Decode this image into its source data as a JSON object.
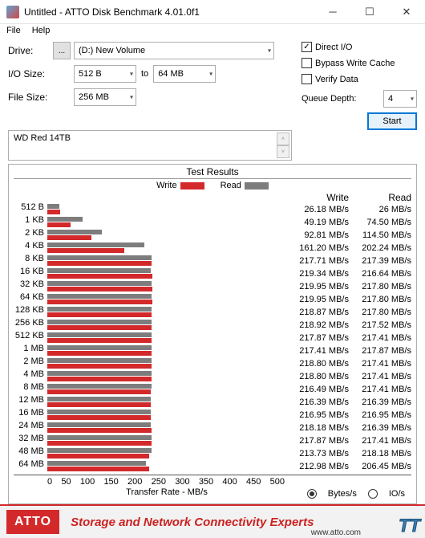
{
  "window": {
    "title": "Untitled - ATTO Disk Benchmark 4.01.0f1"
  },
  "menu": {
    "file": "File",
    "help": "Help"
  },
  "config": {
    "drive_label": "Drive:",
    "dots": "...",
    "drive_value": "(D:) New Volume",
    "io_label": "I/O Size:",
    "io_from": "512 B",
    "io_to_label": "to",
    "io_to": "64 MB",
    "fsize_label": "File Size:",
    "fsize_value": "256 MB"
  },
  "options": {
    "direct_io": "Direct I/O",
    "bypass": "Bypass Write Cache",
    "verify": "Verify Data",
    "qd_label": "Queue Depth:",
    "qd_value": "4",
    "start": "Start"
  },
  "description": "WD Red 14TB",
  "results": {
    "header": "Test Results",
    "write_label": "Write",
    "read_label": "Read",
    "transfer_label": "Transfer Rate - MB/s",
    "bytes_label": "Bytes/s",
    "ios_label": "IO/s"
  },
  "footer": {
    "logo": "ATTO",
    "slogan": "Storage and Network Connectivity Experts",
    "url": "www.atto.com",
    "watermark": "TT"
  },
  "chart_data": {
    "type": "bar",
    "xlabel": "Transfer Rate - MB/s",
    "xlim": [
      0,
      500
    ],
    "xticks": [
      0,
      50,
      100,
      150,
      200,
      250,
      300,
      350,
      400,
      450,
      500
    ],
    "series": [
      {
        "name": "Write",
        "color": "#d3292b"
      },
      {
        "name": "Read",
        "color": "#7d7d7d"
      }
    ],
    "rows": [
      {
        "label": "512 B",
        "write": 26.18,
        "read": 26.0,
        "write_s": "26.18 MB/s",
        "read_s": "26 MB/s"
      },
      {
        "label": "1 KB",
        "write": 49.19,
        "read": 74.5,
        "write_s": "49.19 MB/s",
        "read_s": "74.50 MB/s"
      },
      {
        "label": "2 KB",
        "write": 92.81,
        "read": 114.5,
        "write_s": "92.81 MB/s",
        "read_s": "114.50 MB/s"
      },
      {
        "label": "4 KB",
        "write": 161.2,
        "read": 202.24,
        "write_s": "161.20 MB/s",
        "read_s": "202.24 MB/s"
      },
      {
        "label": "8 KB",
        "write": 217.71,
        "read": 217.39,
        "write_s": "217.71 MB/s",
        "read_s": "217.39 MB/s"
      },
      {
        "label": "16 KB",
        "write": 219.34,
        "read": 216.64,
        "write_s": "219.34 MB/s",
        "read_s": "216.64 MB/s"
      },
      {
        "label": "32 KB",
        "write": 219.95,
        "read": 217.8,
        "write_s": "219.95 MB/s",
        "read_s": "217.80 MB/s"
      },
      {
        "label": "64 KB",
        "write": 219.95,
        "read": 217.8,
        "write_s": "219.95 MB/s",
        "read_s": "217.80 MB/s"
      },
      {
        "label": "128 KB",
        "write": 218.87,
        "read": 217.8,
        "write_s": "218.87 MB/s",
        "read_s": "217.80 MB/s"
      },
      {
        "label": "256 KB",
        "write": 218.92,
        "read": 217.52,
        "write_s": "218.92 MB/s",
        "read_s": "217.52 MB/s"
      },
      {
        "label": "512 KB",
        "write": 217.87,
        "read": 217.41,
        "write_s": "217.87 MB/s",
        "read_s": "217.41 MB/s"
      },
      {
        "label": "1 MB",
        "write": 217.41,
        "read": 217.87,
        "write_s": "217.41 MB/s",
        "read_s": "217.87 MB/s"
      },
      {
        "label": "2 MB",
        "write": 218.8,
        "read": 217.41,
        "write_s": "218.80 MB/s",
        "read_s": "217.41 MB/s"
      },
      {
        "label": "4 MB",
        "write": 218.8,
        "read": 217.41,
        "write_s": "218.80 MB/s",
        "read_s": "217.41 MB/s"
      },
      {
        "label": "8 MB",
        "write": 216.49,
        "read": 217.41,
        "write_s": "216.49 MB/s",
        "read_s": "217.41 MB/s"
      },
      {
        "label": "12 MB",
        "write": 216.39,
        "read": 216.39,
        "write_s": "216.39 MB/s",
        "read_s": "216.39 MB/s"
      },
      {
        "label": "16 MB",
        "write": 216.95,
        "read": 216.95,
        "write_s": "216.95 MB/s",
        "read_s": "216.95 MB/s"
      },
      {
        "label": "24 MB",
        "write": 218.18,
        "read": 216.39,
        "write_s": "218.18 MB/s",
        "read_s": "216.39 MB/s"
      },
      {
        "label": "32 MB",
        "write": 217.87,
        "read": 217.41,
        "write_s": "217.87 MB/s",
        "read_s": "217.41 MB/s"
      },
      {
        "label": "48 MB",
        "write": 213.73,
        "read": 218.18,
        "write_s": "213.73 MB/s",
        "read_s": "218.18 MB/s"
      },
      {
        "label": "64 MB",
        "write": 212.98,
        "read": 206.45,
        "write_s": "212.98 MB/s",
        "read_s": "206.45 MB/s"
      }
    ]
  }
}
